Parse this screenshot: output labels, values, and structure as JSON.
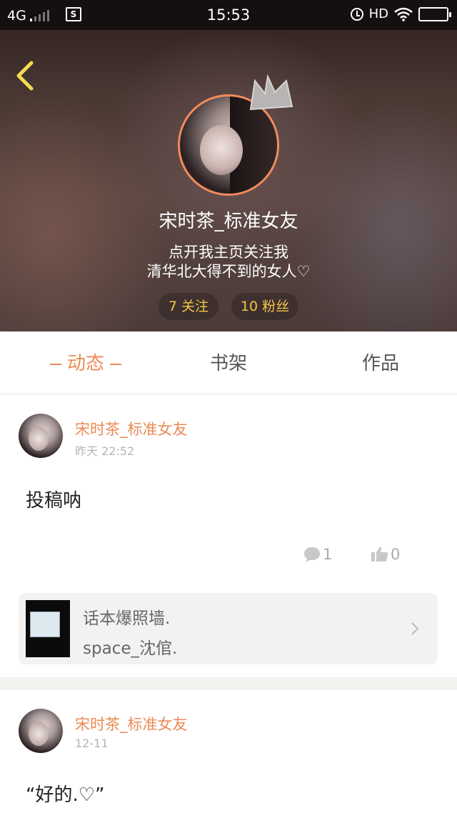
{
  "status_bar": {
    "network": "4G",
    "time": "15:53",
    "hd": "HD",
    "sim_glyph": "S"
  },
  "profile": {
    "name": "宋时茶_标准女友",
    "bio_line1": "点开我主页关注我",
    "bio_line2": "清华北大得不到的女人♡",
    "following": "7 关注",
    "followers": "10 粉丝"
  },
  "tabs": [
    {
      "label": "动态",
      "active": true
    },
    {
      "label": "书架",
      "active": false
    },
    {
      "label": "作品",
      "active": false
    }
  ],
  "colors": {
    "accent": "#ec8a55",
    "avatar_ring": "#f28c5c",
    "stat_text": "#f3c545"
  },
  "posts": [
    {
      "author": "宋时茶_标准女友",
      "time": "昨天 22:52",
      "text": "投稿呐",
      "comments": "1",
      "likes": "0",
      "share_card": {
        "title": "话本爆照墙.",
        "subtitle": "space_沈倌."
      }
    },
    {
      "author": "宋时茶_标准女友",
      "time": "12-11",
      "text": "“好的.♡”"
    }
  ]
}
